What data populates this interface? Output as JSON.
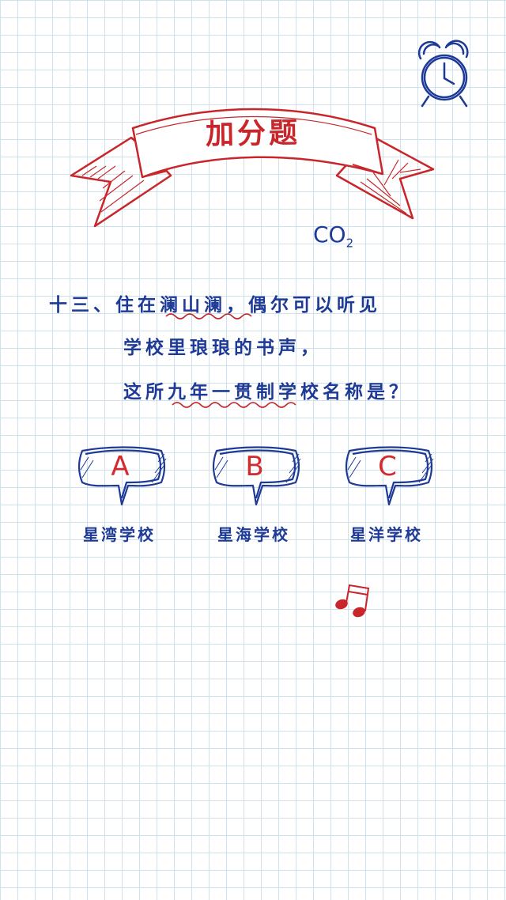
{
  "banner": {
    "title": "加分题"
  },
  "formula": {
    "main": "CO",
    "sub": "2"
  },
  "question": {
    "line1": "十三、住在澜山澜，偶尔可以听见",
    "line2": "学校里琅琅的书声，",
    "line3": "这所九年一贯制学校名称是？"
  },
  "options": [
    {
      "letter": "A",
      "label": "星湾学校"
    },
    {
      "letter": "B",
      "label": "星海学校"
    },
    {
      "letter": "C",
      "label": "星洋学校"
    }
  ],
  "colors": {
    "blue": "#1d3a96",
    "red": "#c8262a",
    "grid": "#cfe1ec"
  },
  "icons": [
    "alarm-clock-icon",
    "music-note-icon"
  ]
}
